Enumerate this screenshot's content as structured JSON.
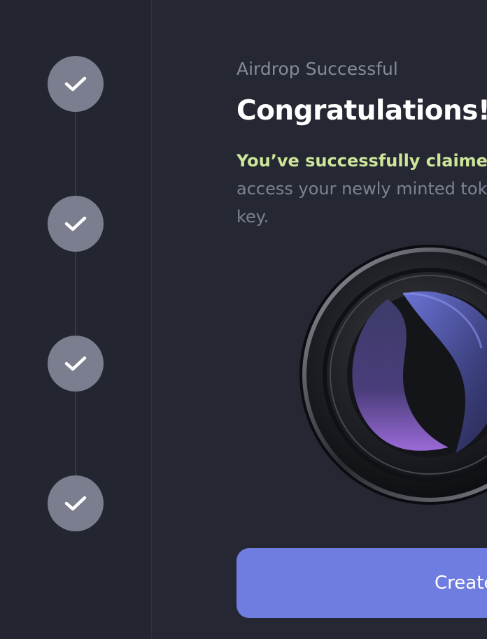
{
  "steps": [
    {
      "state": "complete",
      "icon": "check-icon"
    },
    {
      "state": "complete",
      "icon": "check-icon"
    },
    {
      "state": "complete",
      "icon": "check-icon"
    },
    {
      "state": "complete",
      "icon": "check-icon"
    }
  ],
  "header": {
    "eyebrow": "Airdrop Successful",
    "title": "Congratulations!"
  },
  "message": {
    "highlight": "You’ve successfully claimed",
    "line2": "access your newly minted tok",
    "line3": "key."
  },
  "token": {
    "icon": "token-coin-icon"
  },
  "cta": {
    "label": "Create"
  },
  "colors": {
    "background": "#252732",
    "accent": "#6f7ce0",
    "highlight": "#cde69a",
    "step": "#7a7e8e"
  }
}
